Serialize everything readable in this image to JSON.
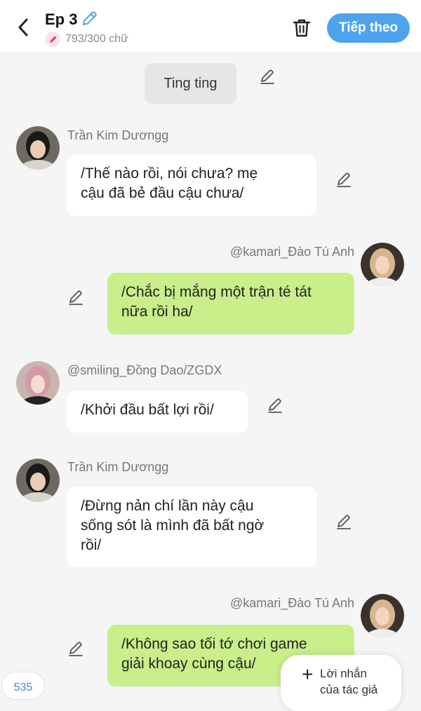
{
  "header": {
    "title": "Ep 3",
    "word_count": "793/300 chữ",
    "next_label": "Tiếp theo"
  },
  "colors": {
    "accent": "#4da3ee",
    "bubble_sent": "#c9ee8a",
    "bubble_received": "#ffffff",
    "background": "#f5f5f5"
  },
  "narration": {
    "text": "Ting ting"
  },
  "messages": [
    {
      "sender": "Trần Kim Dươngg",
      "side": "left",
      "lines": [
        "/Thế nào rồi, nói chưa? mẹ",
        "cậu đã bẻ đầu cậu chưa/"
      ]
    },
    {
      "sender": "@kamari_Đào Tú Anh",
      "side": "right",
      "lines": [
        "/Chắc bị mắng một trận té tát",
        "nữa rồi ha/"
      ]
    },
    {
      "sender": "@smiling_Đồng Dao/ZGDX",
      "side": "left",
      "lines": [
        "/Khởi đầu bất lợi rồi/"
      ]
    },
    {
      "sender": "Trần Kim Dươngg",
      "side": "left",
      "lines": [
        "/Đừng nản chí lần này cậu",
        "sống sót là mình đã bất ngờ",
        "rồi/"
      ]
    },
    {
      "sender": "@kamari_Đào Tú Anh",
      "side": "right",
      "lines": [
        "/Không sao tối tớ chơi game",
        "giải khoay cùng cậu/"
      ]
    }
  ],
  "footer": {
    "page_count": "535",
    "author_note_line1": "Lời nhắn",
    "author_note_line2": "của tác giả"
  },
  "icons": [
    "back-arrow-icon",
    "pencil-icon",
    "trash-icon",
    "plus-icon"
  ]
}
